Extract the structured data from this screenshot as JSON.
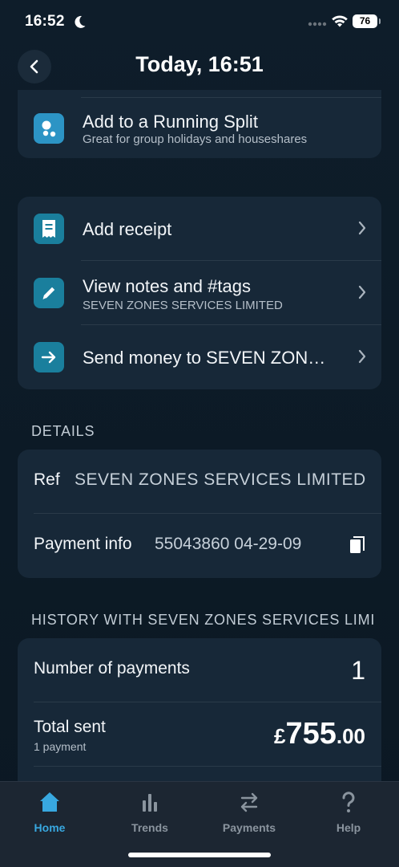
{
  "status_bar": {
    "time": "16:52",
    "battery": "76"
  },
  "nav": {
    "title": "Today, 16:51"
  },
  "split": {
    "title": "Add to a Running Split",
    "subtitle": "Great for group holidays and houseshares"
  },
  "actions": [
    {
      "title": "Add receipt",
      "icon": "receipt-icon"
    },
    {
      "title": "View notes and #tags",
      "subtitle": "SEVEN ZONES SERVICES LIMITED",
      "icon": "pencil-icon"
    },
    {
      "title": "Send money to SEVEN ZON…",
      "icon": "arrow-right-icon"
    }
  ],
  "details": {
    "header": "DETAILS",
    "ref_label": "Ref",
    "ref_value": "SEVEN ZONES SERVICES LIMITED",
    "payment_label": "Payment info",
    "payment_value": "55043860 04-29-09"
  },
  "history": {
    "header": "HISTORY WITH SEVEN ZONES SERVICES LIMI",
    "count_label": "Number of payments",
    "count_value": "1",
    "total_label": "Total sent",
    "total_sub": "1 payment",
    "total_currency": "£",
    "total_major": "755",
    "total_minor": ".00"
  },
  "tabs": [
    {
      "label": "Home",
      "icon": "home-icon",
      "active": true
    },
    {
      "label": "Trends",
      "icon": "bar-chart-icon",
      "active": false
    },
    {
      "label": "Payments",
      "icon": "transfer-arrows-icon",
      "active": false
    },
    {
      "label": "Help",
      "icon": "question-mark-icon",
      "active": false
    }
  ],
  "colors": {
    "accent": "#38a8e0",
    "icon_teal": "#1a7f9d",
    "card": "#172838",
    "background": "#0c1a26"
  }
}
